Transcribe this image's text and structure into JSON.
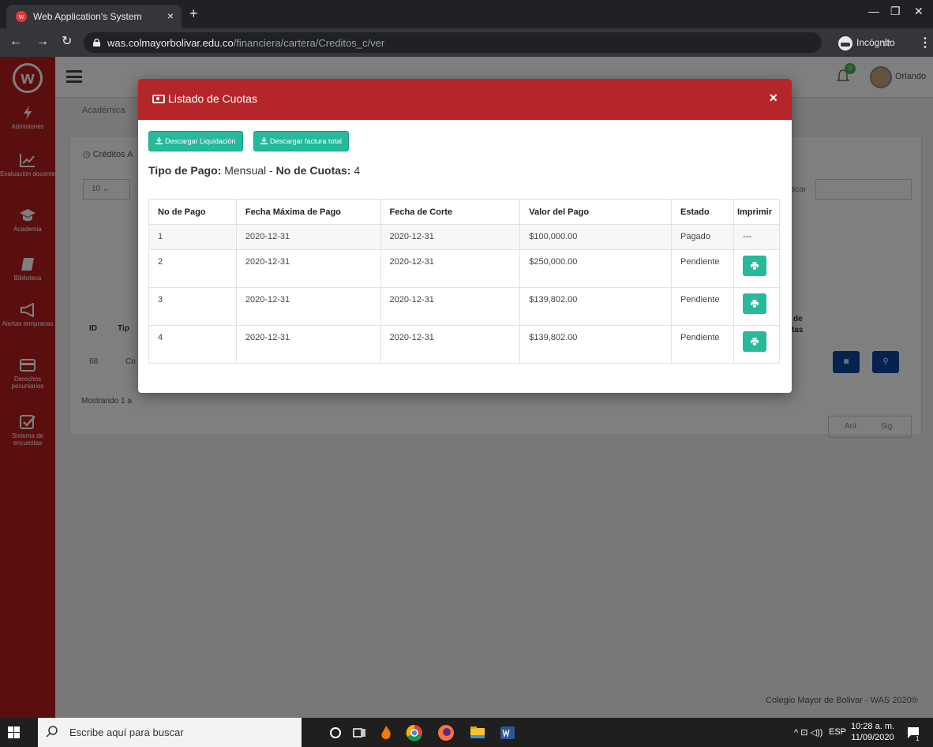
{
  "browser": {
    "tab_title": "Web Application's System",
    "tab_close": "×",
    "new_tab": "+",
    "url_host": "was.colmayorbolivar.edu.co",
    "url_path": "/financiera/cartera/Creditos_c/ver",
    "incognito_label": "Incógnito"
  },
  "sidebar": {
    "logo": "w",
    "items": [
      {
        "label": "Admisiones",
        "icon": "bolt-icon"
      },
      {
        "label": "Evaluación docente",
        "icon": "chart-line-icon"
      },
      {
        "label": "Academia",
        "icon": "graduation-cap-icon"
      },
      {
        "label": "Biblioteca",
        "icon": "book-icon"
      },
      {
        "label": "Alertas tempranas",
        "icon": "bullhorn-icon"
      },
      {
        "label": "Derechos pecuniarios",
        "icon": "credit-card-icon"
      },
      {
        "label": "Sistema de encuestas",
        "icon": "check-square-icon"
      }
    ]
  },
  "header": {
    "notifications_count": "0",
    "user_name": "Orlando"
  },
  "background": {
    "breadcrumb": "Académica",
    "card_title": "Créditos A",
    "length_value": "10",
    "search_label": "uscar",
    "columns": [
      "ID",
      "Tip",
      "de",
      "tas"
    ],
    "row": {
      "id": "68",
      "type": "Co"
    },
    "showing": "Mostrando 1 a",
    "pager_prev": "Ant",
    "pager_next": "Sig",
    "footer": "Colegio Mayor de Bolivar - WAS 2020®"
  },
  "modal": {
    "title": "Listado de Cuotas",
    "close": "×",
    "btn_liquidacion": "Descargar Liquidación",
    "btn_factura": "Descargar factura total",
    "tipo_pago_label": "Tipo de Pago:",
    "tipo_pago_value": "Mensual",
    "separator": "-",
    "cuotas_label": "No de Cuotas:",
    "cuotas_value": "4",
    "table": {
      "headers": [
        "No de Pago",
        "Fecha Máxima de Pago",
        "Fecha de Corte",
        "Valor del Pago",
        "Estado",
        "Imprimir"
      ],
      "rows": [
        {
          "no": "1",
          "fecha_max": "2020-12-31",
          "fecha_corte": "2020-12-31",
          "valor": "$100,000.00",
          "estado": "Pagado",
          "imprimir": "---"
        },
        {
          "no": "2",
          "fecha_max": "2020-12-31",
          "fecha_corte": "2020-12-31",
          "valor": "$250,000.00",
          "estado": "Pendiente",
          "imprimir": "print-icon"
        },
        {
          "no": "3",
          "fecha_max": "2020-12-31",
          "fecha_corte": "2020-12-31",
          "valor": "$139,802.00",
          "estado": "Pendiente",
          "imprimir": "print-icon"
        },
        {
          "no": "4",
          "fecha_max": "2020-12-31",
          "fecha_corte": "2020-12-31",
          "valor": "$139,802.00",
          "estado": "Pendiente",
          "imprimir": "print-icon"
        }
      ]
    }
  },
  "taskbar": {
    "search_placeholder": "Escribe aquí para buscar",
    "language": "ESP",
    "time": "10:28 a. m.",
    "date": "11/09/2020",
    "notif_count": "1"
  },
  "colors": {
    "brand_red": "#b5262b",
    "sidebar_red": "#b71c1c",
    "action_green": "#26b99a",
    "info_blue": "#0d47a1"
  }
}
